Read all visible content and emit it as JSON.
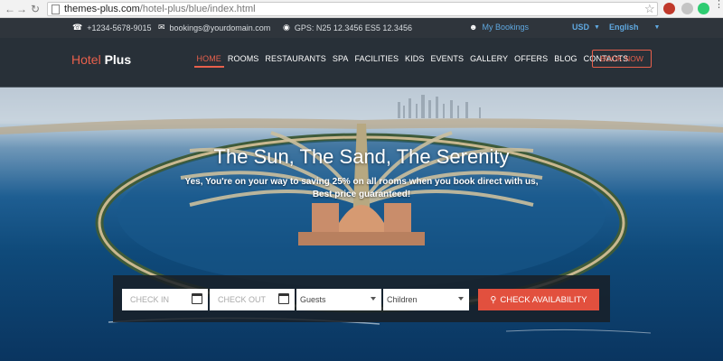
{
  "browser": {
    "url_host": "themes-plus.com",
    "url_path": "/hotel-plus/blue/index.html"
  },
  "topbar": {
    "phone": "+1234-5678-9015",
    "email": "bookings@yourdomain.com",
    "gps": "GPS: N25 12.3456 ES5 12.3456",
    "my_bookings": "My Bookings",
    "currency": "USD",
    "language": "English"
  },
  "header": {
    "logo_a": "Hotel",
    "logo_b": "Plus",
    "nav": [
      "HOME",
      "ROOMS",
      "RESTAURANTS",
      "SPA",
      "FACILITIES",
      "KIDS",
      "EVENTS",
      "GALLERY",
      "OFFERS",
      "BLOG",
      "CONTACTS"
    ],
    "active": "HOME",
    "book_now": "BOOK NOW"
  },
  "hero": {
    "title": "The Sun, The Sand, The Serenity",
    "subtitle_line1": "Yes, You're on your way to saving 25% on all rooms when you book direct with us,",
    "subtitle_line2": "Best price guaranteed!"
  },
  "booking": {
    "check_in": "CHECK IN",
    "check_out": "CHECK OUT",
    "guests": "Guests",
    "children": "Children",
    "submit": "CHECK AVAILABILITY"
  },
  "colors": {
    "accent": "#e8604c",
    "link_blue": "#5fa8e0",
    "dark_bar": "#2f353c"
  }
}
